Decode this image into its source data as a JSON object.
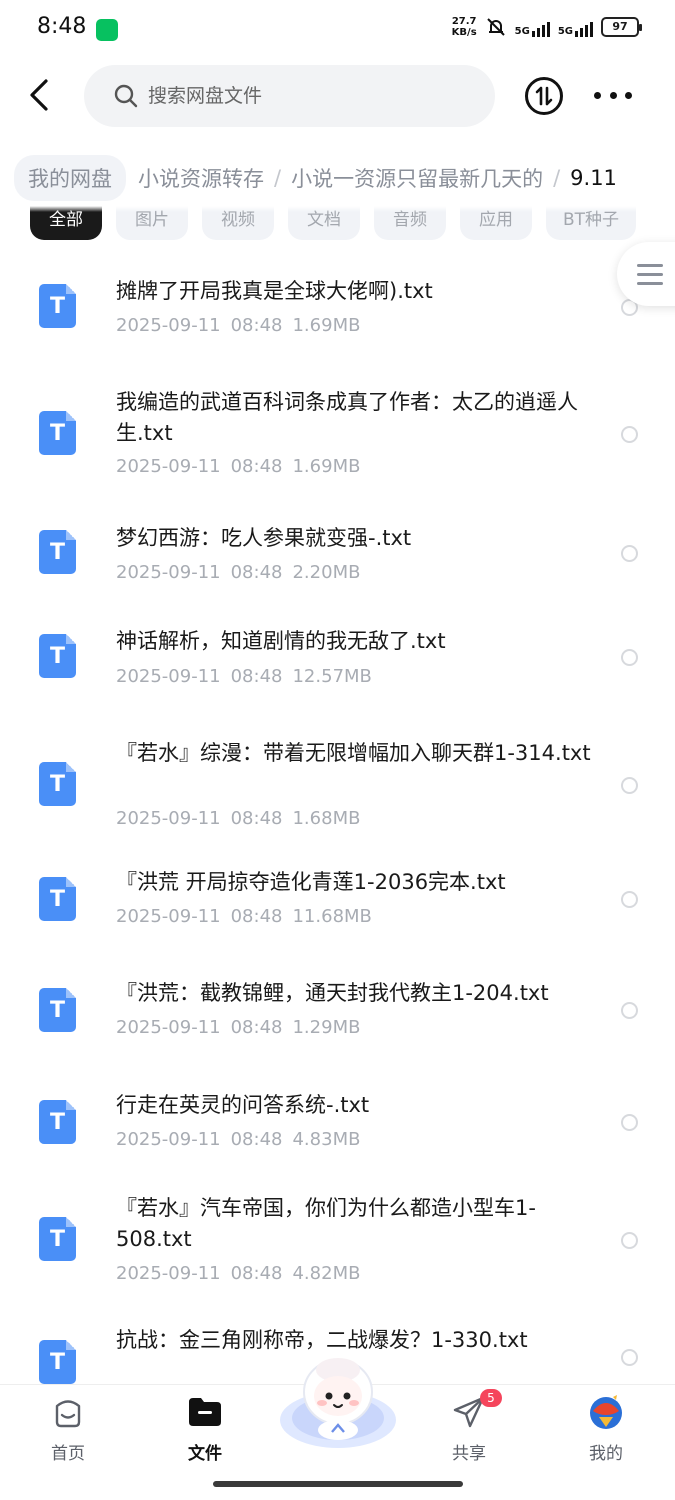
{
  "status": {
    "time": "8:48",
    "net_speed_value": "27.7",
    "net_speed_unit": "KB/s",
    "sig1": "5G",
    "sig2": "5G",
    "battery": "97"
  },
  "search": {
    "placeholder": "搜索网盘文件"
  },
  "breadcrumb": {
    "root": "我的网盘",
    "items": [
      "小说资源转存",
      "小说一资源只留最新几天的"
    ],
    "sep": "/",
    "current": "9.11"
  },
  "filters": [
    "全部",
    "图片",
    "视频",
    "文档",
    "音频",
    "应用",
    "BT种子"
  ],
  "files": [
    {
      "name": "摊牌了开局我真是全球大佬啊).txt",
      "date": "2025-09-11",
      "time": "08:48",
      "size": "1.69MB"
    },
    {
      "name": "我编造的武道百科词条成真了作者：太乙的逍遥人生.txt",
      "date": "2025-09-11",
      "time": "08:48",
      "size": "1.69MB"
    },
    {
      "name": "梦幻西游：吃人参果就变强-.txt",
      "date": "2025-09-11",
      "time": "08:48",
      "size": "2.20MB"
    },
    {
      "name": "神话解析，知道剧情的我无敌了.txt",
      "date": "2025-09-11",
      "time": "08:48",
      "size": "12.57MB"
    },
    {
      "name": "『若水』综漫：带着无限增幅加入聊天群1-314.txt",
      "date": "2025-09-11",
      "time": "08:48",
      "size": "1.68MB"
    },
    {
      "name": "『洪荒 开局掠夺造化青莲1-2036完本.txt",
      "date": "2025-09-11",
      "time": "08:48",
      "size": "11.68MB"
    },
    {
      "name": "『洪荒：截教锦鲤，通天封我代教主1-204.txt",
      "date": "2025-09-11",
      "time": "08:48",
      "size": "1.29MB"
    },
    {
      "name": "行走在英灵的问答系统-.txt",
      "date": "2025-09-11",
      "time": "08:48",
      "size": "4.83MB"
    },
    {
      "name": "『若水』汽车帝国，你们为什么都造小型车1-508.txt",
      "date": "2025-09-11",
      "time": "08:48",
      "size": "4.82MB"
    },
    {
      "name": "抗战：金三角刚称帝，二战爆发？1-330.txt",
      "date": "",
      "time": "",
      "size": ""
    }
  ],
  "file_icon_letter": "T",
  "nav": {
    "home": "首页",
    "files": "文件",
    "share": "共享",
    "share_badge": "5",
    "mine": "我的"
  },
  "colors": {
    "file_icon": "#4a8ff7",
    "badge": "#f5455c",
    "active_chip": "#1a1a1a"
  }
}
